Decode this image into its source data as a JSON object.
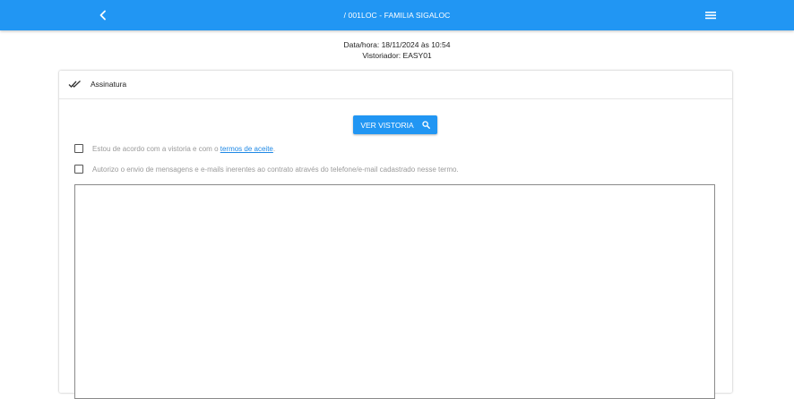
{
  "header": {
    "title": "/ 001LOC - FAMILIA SIGALOC",
    "back_icon": "chevron-left-icon",
    "menu_icon": "hamburger-menu-icon",
    "color": "#2196f3"
  },
  "info": {
    "datetime": "Data/hora: 18/11/2024 às 10:54",
    "inspector": "Vistoriador: EASY01"
  },
  "card": {
    "title": "Assinatura",
    "title_icon": "double-check-icon",
    "view_button_label": "VER VISTORIA",
    "view_button_icon": "search-icon",
    "agree_text": "Estou de acordo com a vistoria e com o ",
    "agree_link": "termos de aceite",
    "agree_suffix": ".",
    "authorize_text": "Autorizo o envio de mensagens e e-mails inerentes ao contrato através do telefone/e-mail cadastrado nesse termo.",
    "agree_checked": false,
    "authorize_checked": false
  }
}
